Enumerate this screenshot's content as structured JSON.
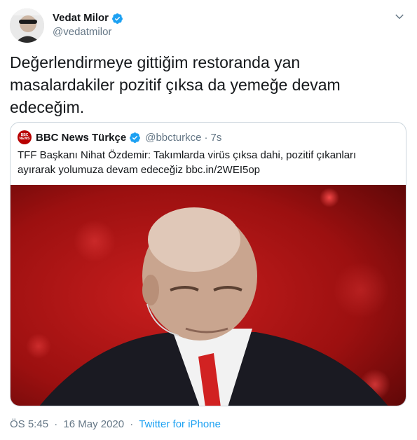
{
  "author": {
    "display_name": "Vedat Milor",
    "handle": "@vedatmilor",
    "verified": true
  },
  "tweet": {
    "text": "Değerlendirmeye gittiğim restoranda yan masalardakiler pozitif çıksa da yemeğe devam edeceğim."
  },
  "quoted_tweet": {
    "logo_text_top": "BBC",
    "logo_text_bottom": "NEWS",
    "display_name": "BBC News Türkçe",
    "handle": "@bbcturkce",
    "separator": "·",
    "time": "7s",
    "text": "TFF Başkanı Nihat Özdemir: Takımlarda virüs çıksa dahi, pozitif çıkanları ayırarak yolumuza devam edeceğiz",
    "link": "bbc.in/2WEI5op"
  },
  "footer": {
    "time": "ÖS 5:45",
    "separator": "·",
    "date": "16 May 2020",
    "separator2": "·",
    "source": "Twitter for iPhone"
  },
  "icons": {
    "verified": "verified-badge-icon",
    "caret": "chevron-down-icon"
  },
  "colors": {
    "brand_blue": "#1da1f2",
    "bbc_red": "#b80000",
    "muted": "#657786",
    "border": "#ccd6dd"
  }
}
